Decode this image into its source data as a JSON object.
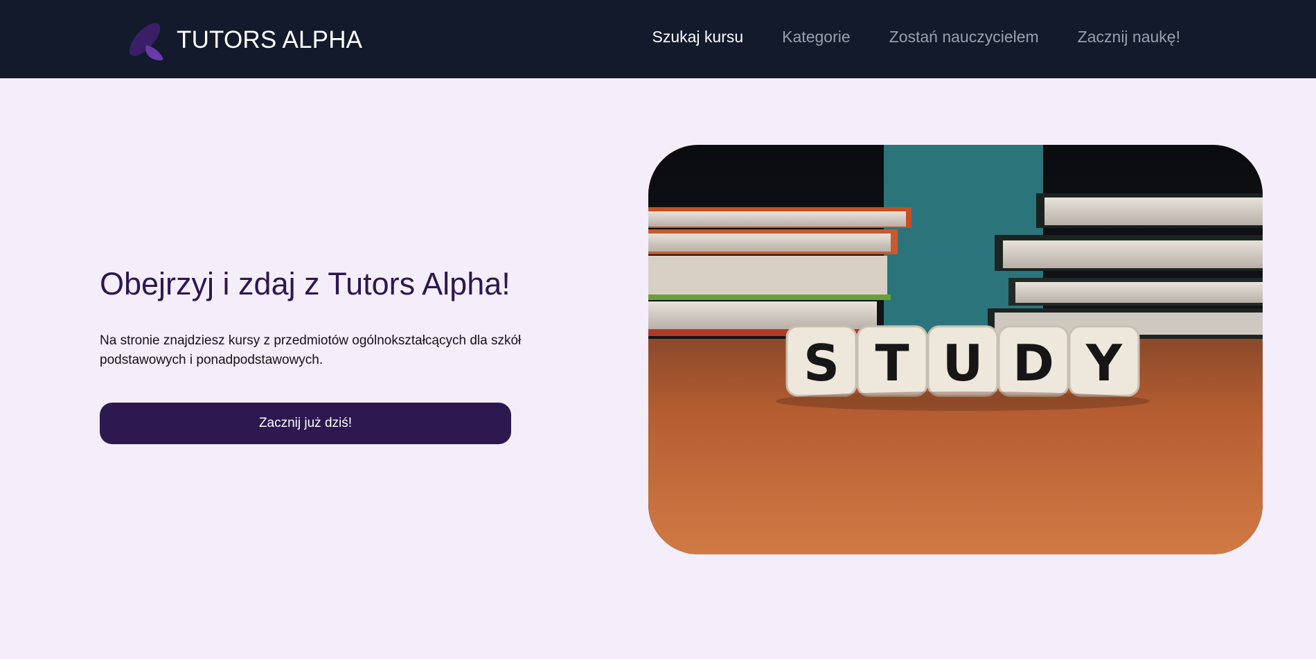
{
  "header": {
    "brand": "TUTORS ALPHA",
    "logo_icon": "purple-leaf-logo-icon",
    "nav": [
      {
        "label": "Szukaj kursu",
        "active": true
      },
      {
        "label": "Kategorie",
        "active": false
      },
      {
        "label": "Zostań nauczycielem",
        "active": false
      },
      {
        "label": "Zacznij naukę!",
        "active": false
      }
    ]
  },
  "hero": {
    "title": "Obejrzyj i zdaj z Tutors Alpha!",
    "text": "Na stronie znajdziesz kursy z przedmiotów ogólnokształcących dla szkół podstawowych i ponadpodstawowych.",
    "cta_label": "Zacznij już dziś!",
    "image": {
      "description_icon": "study-dice-books-photo",
      "dice_letters": [
        "S",
        "T",
        "U",
        "D",
        "Y"
      ]
    }
  },
  "colors": {
    "navbar_bg": "#121a2c",
    "page_bg": "#f4eefb",
    "accent": "#2e1850",
    "nav_inactive": "#9aa0ad",
    "nav_active": "#ffffff"
  }
}
